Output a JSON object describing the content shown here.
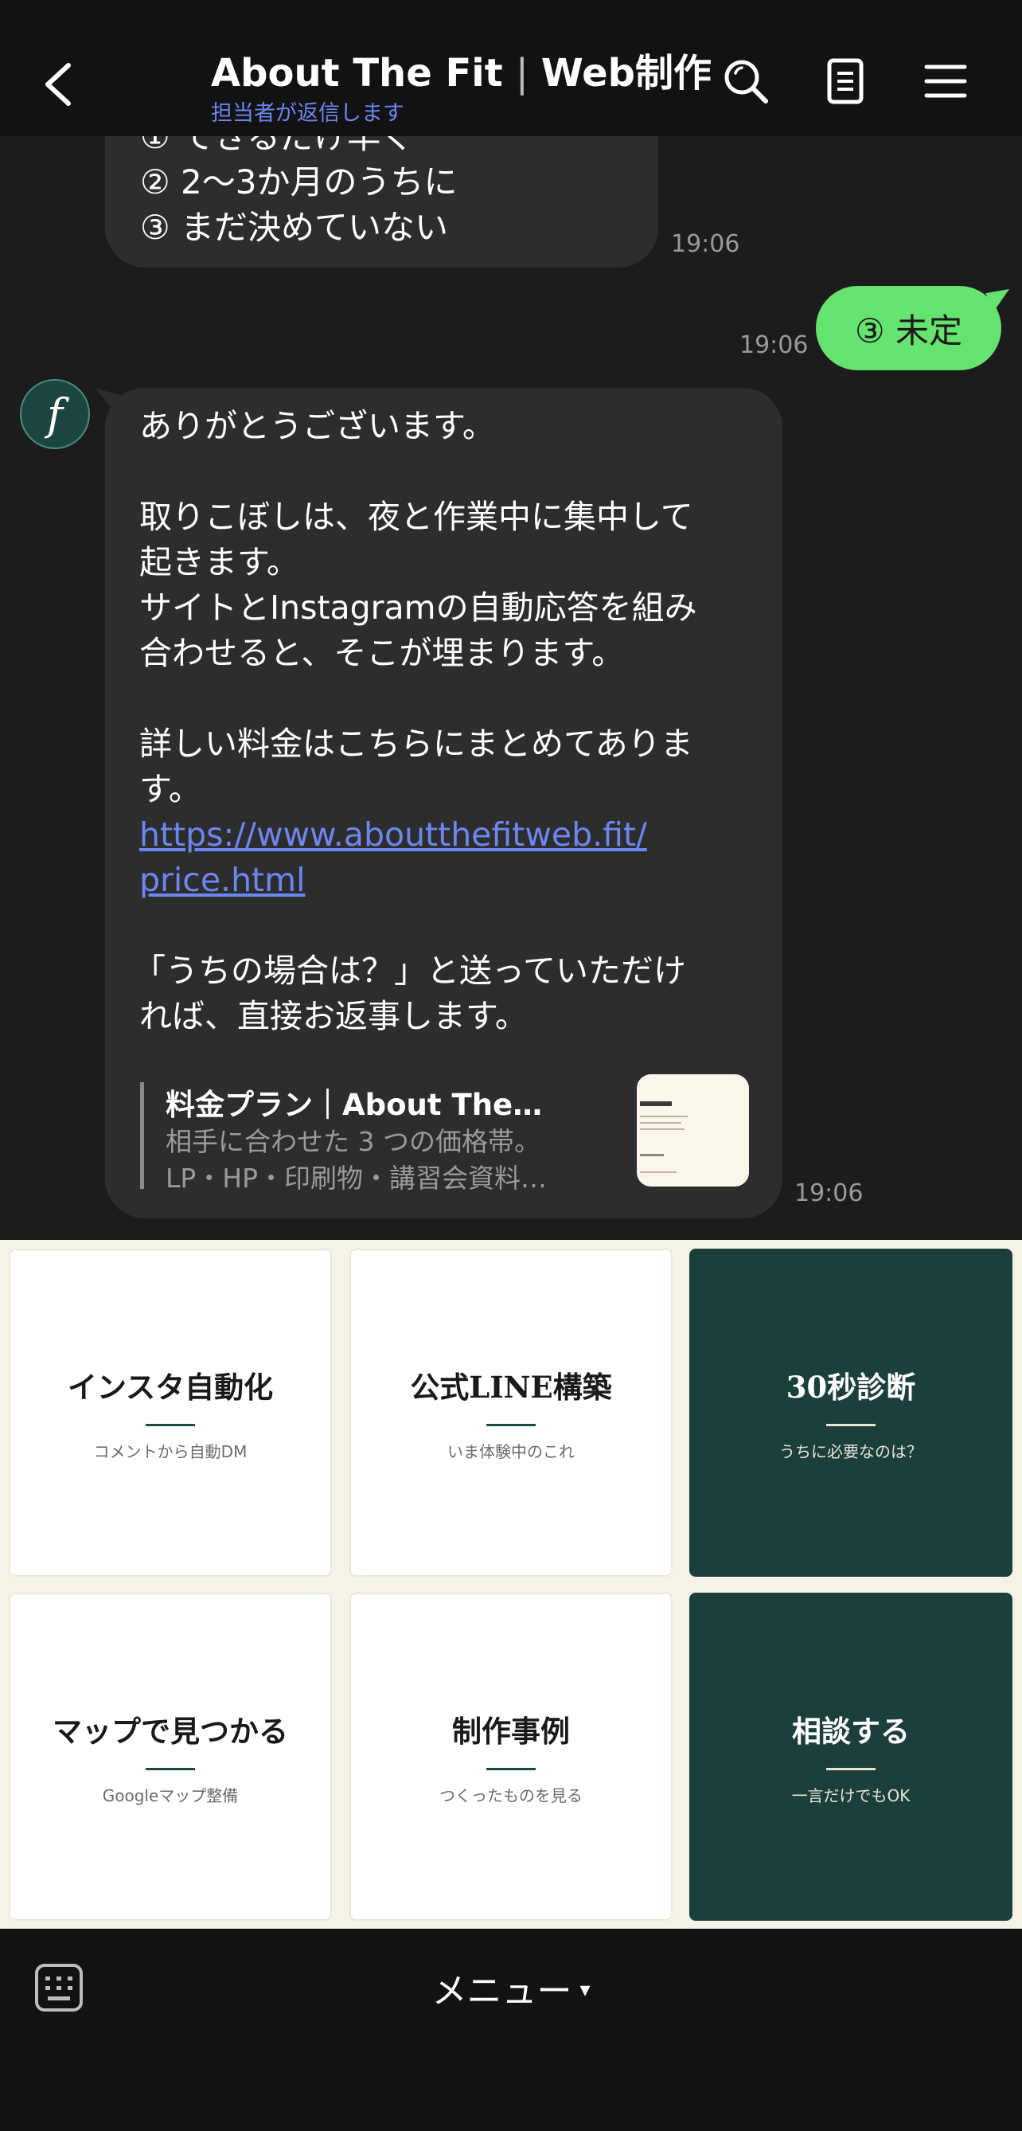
{
  "header": {
    "title": "About The Fit",
    "title_suffix": "Web制作",
    "subtitle": "担当者が返信します"
  },
  "chat": {
    "previous_lines": [
      "① できるだけ早く",
      "② 2〜3か月のうちに",
      "③ まだ決めていない"
    ],
    "previous_time": "19:06",
    "outgoing": {
      "text": "③ 未定",
      "time": "19:06"
    },
    "incoming": {
      "avatar_letter": "f",
      "lines": [
        "ありがとうございます。",
        "",
        "取りこぼしは、夜と作業中に集中して",
        "起きます。",
        "サイトとInstagramの自動応答を組み",
        "合わせると、そこが埋まります。",
        "",
        "詳しい料金はこちらにまとめてありま",
        "す。"
      ],
      "link_lines": [
        "https://www.aboutthefitweb.fit/",
        "price.html"
      ],
      "closing_lines": [
        "",
        "「うちの場合は？」と送っていただけ",
        "れば、直接お返事します。"
      ],
      "preview": {
        "title": "料金プラン｜About The…",
        "desc_line1": "相手に合わせた 3 つの価格帯。",
        "desc_line2": "LP・HP・印刷物・講習会資料…"
      },
      "time": "19:06"
    }
  },
  "richmenu": {
    "tiles": [
      {
        "title": "インスタ自動化",
        "sub": "コメントから自動DM",
        "style": "light"
      },
      {
        "title": "公式LINE構築",
        "sub": "いま体験中のこれ",
        "style": "light"
      },
      {
        "title": "30秒診断",
        "sub": "うちに必要なのは？",
        "style": "dark"
      },
      {
        "title": "マップで見つかる",
        "sub": "Googleマップ整備",
        "style": "light"
      },
      {
        "title": "制作事例",
        "sub": "つくったものを見る",
        "style": "light"
      },
      {
        "title": "相談する",
        "sub": "一言だけでもOK",
        "style": "dark"
      }
    ]
  },
  "bottombar": {
    "menu_label": "メニュー",
    "caret": "▾"
  },
  "colors": {
    "background": "#1c1c1c",
    "header": "#121212",
    "bubble_in": "#2d2d2d",
    "bubble_out": "#66e36f",
    "link": "#6c86f2",
    "richmenu_dark": "#1b3f3b",
    "richmenu_bg": "#f6f2e7"
  },
  "icons": [
    "back-icon",
    "search-icon",
    "note-icon",
    "menu-icon",
    "keyboard-icon"
  ]
}
